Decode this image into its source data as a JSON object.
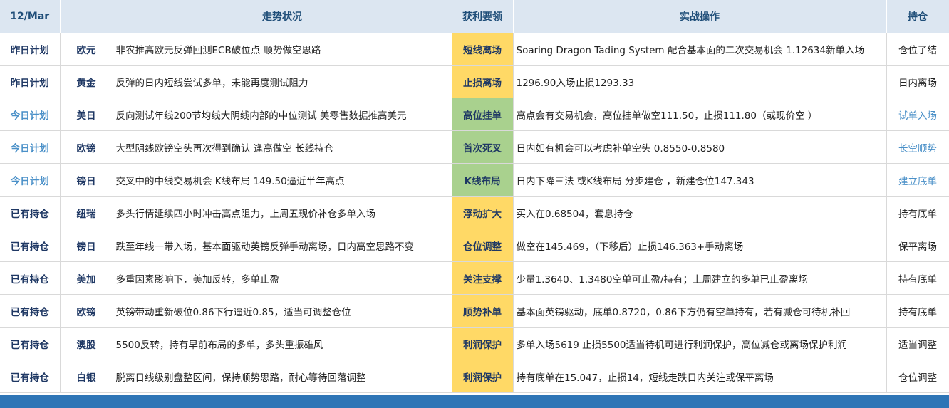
{
  "header": {
    "date": "12/Mar",
    "trend": "走势状况",
    "profit": "获利要领",
    "action": "实战操作",
    "position": "持仓"
  },
  "rows": [
    {
      "plan": "昨日计划",
      "asset": "欧元",
      "trend": "非农推高欧元反弹回测ECB破位点 顺势做空思路",
      "profit": "短线离场",
      "profit_color": "yellow",
      "action": " Soaring Dragon Tading System 配合基本面的二次交易机会 1.12634新单入场",
      "position": "仓位了结"
    },
    {
      "plan": "昨日计划",
      "asset": "黄金",
      "trend": "反弹的日内短线尝试多单，未能再度测试阻力",
      "profit": "止损离场",
      "profit_color": "yellow",
      "action": "1296.90入场止损1293.33",
      "position": "日内离场"
    },
    {
      "plan": "今日计划",
      "asset": "美日",
      "trend": "反向测试年线200节均线大阴线内部的中位测试     美零售数据推高美元",
      "profit": "高位挂单",
      "profit_color": "green",
      "action": "高点会有交易机会，高位挂单做空111.50，止损111.80（或现价空 ）",
      "position": "试单入场"
    },
    {
      "plan": "今日计划",
      "asset": "欧镑",
      "trend": "大型阴线欧镑空头再次得到确认  逢高做空  长线持仓",
      "profit": "首次死叉",
      "profit_color": "green",
      "action": "日内如有机会可以考虑补单空头    0.8550-0.8580",
      "position": "长空顺势"
    },
    {
      "plan": "今日计划",
      "asset": "镑日",
      "trend": "交叉中的中线交易机会     K线布局  149.50逼近半年高点",
      "profit": "K线布局",
      "profit_color": "green",
      "action": "日内下降三法 或K线布局 分步建仓 ，新建仓位147.343",
      "position": "建立底单"
    },
    {
      "plan": "已有持仓",
      "asset": "纽瑞",
      "trend": "多头行情延续四小时冲击高点阻力，上周五现价补仓多单入场",
      "profit": "浮动扩大",
      "profit_color": "yellow",
      "action": "买入在0.68504，套息持仓",
      "position": "持有底单"
    },
    {
      "plan": "已有持仓",
      "asset": "镑日",
      "trend": "跌至年线一带入场，基本面驱动英镑反弹手动离场，日内高空思路不变",
      "profit": "仓位调整",
      "profit_color": "yellow",
      "action": "做空在145.469，（下移后）止损146.363+手动离场",
      "position": "保平离场"
    },
    {
      "plan": "已有持仓",
      "asset": "美加",
      "trend": "多重因素影响下，美加反转，多单止盈",
      "profit": "关注支撑",
      "profit_color": "yellow",
      "action": "少量1.3640、1.3480空单可止盈/持有；上周建立的多单已止盈离场",
      "position": "持有底单"
    },
    {
      "plan": "已有持仓",
      "asset": "欧镑",
      "trend": "英镑带动重新破位0.86下行逼近0.85，适当可调整仓位",
      "profit": "顺势补单",
      "profit_color": "yellow",
      "action": "基本面英镑驱动，底单0.8720，0.86下方仍有空单持有，若有减仓可待机补回",
      "position": "持有底单"
    },
    {
      "plan": "已有持仓",
      "asset": "澳股",
      "trend": "5500反转，持有早前布局的多单，多头重振雄风",
      "profit": "利润保护",
      "profit_color": "yellow",
      "action": "多单入场5619 止损5500适当待机可进行利润保护，高位减仓或离场保护利润",
      "position": "适当调整"
    },
    {
      "plan": "已有持仓",
      "asset": "白银",
      "trend": "脱离日线级别盘整区间，保持顺势思路，耐心等待回落调整",
      "profit": "利润保护",
      "profit_color": "yellow",
      "action": "持有底单在15.047，止损14，短线走跌日内关注或保平离场",
      "position": "仓位调整"
    }
  ]
}
